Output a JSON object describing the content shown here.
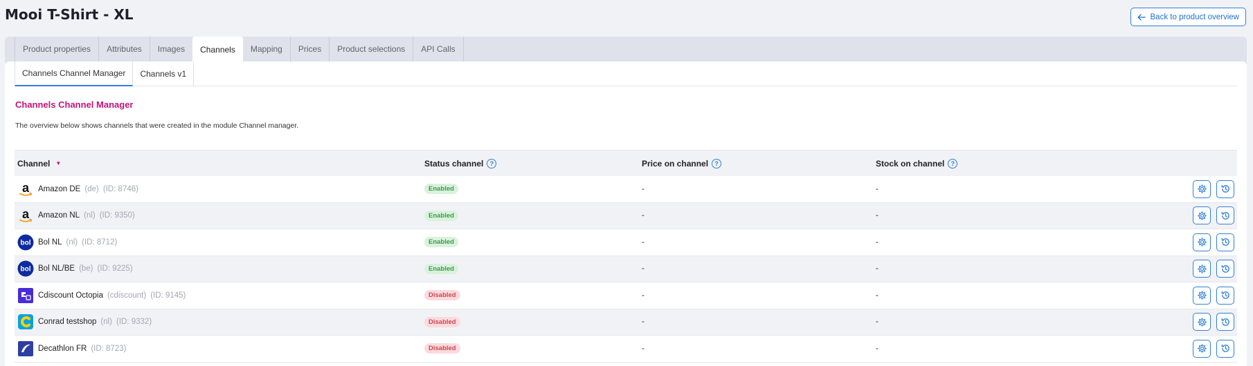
{
  "page": {
    "title": "Mooi T-Shirt - XL",
    "back_label": "Back to product overview"
  },
  "tabs": [
    "Product properties",
    "Attributes",
    "Images",
    "Channels",
    "Mapping",
    "Prices",
    "Product selections",
    "API Calls"
  ],
  "active_tab": "Channels",
  "subtabs": [
    "Channels Channel Manager",
    "Channels v1"
  ],
  "section": {
    "title": "Channels Channel Manager",
    "description": "The overview below shows channels that were created in the module Channel manager."
  },
  "table": {
    "headers": {
      "channel": "Channel",
      "status": "Status channel",
      "price": "Price on channel",
      "stock": "Stock on channel"
    },
    "rows": [
      {
        "logo": "amazon-logo",
        "name": "Amazon DE",
        "code": "(de)",
        "id": "(ID: 8746)",
        "status": "Enabled",
        "price": "-",
        "stock": "-"
      },
      {
        "logo": "amazon-logo",
        "name": "Amazon NL",
        "code": "(nl)",
        "id": "(ID: 9350)",
        "status": "Enabled",
        "price": "-",
        "stock": "-"
      },
      {
        "logo": "bol-logo",
        "name": "Bol NL",
        "code": "(nl)",
        "id": "(ID: 8712)",
        "status": "Enabled",
        "price": "-",
        "stock": "-"
      },
      {
        "logo": "bol-logo",
        "name": "Bol NL/BE",
        "code": "(be)",
        "id": "(ID: 9225)",
        "status": "Enabled",
        "price": "-",
        "stock": "-"
      },
      {
        "logo": "cdiscount-logo",
        "name": "Cdiscount Octopia",
        "code": "(cdiscount)",
        "id": "(ID: 9145)",
        "status": "Disabled",
        "price": "-",
        "stock": "-"
      },
      {
        "logo": "conrad-logo",
        "name": "Conrad testshop",
        "code": "(nl)",
        "id": "(ID: 9332)",
        "status": "Disabled",
        "price": "-",
        "stock": "-"
      },
      {
        "logo": "decathlon-logo",
        "name": "Decathlon FR",
        "code": "",
        "id": "(ID: 8723)",
        "status": "Disabled",
        "price": "-",
        "stock": "-"
      }
    ]
  },
  "colors": {
    "accent": "#2f7fd6",
    "section_title": "#c4127a",
    "enabled_bg": "#d9f2dc",
    "disabled_bg": "#fbdadd"
  }
}
